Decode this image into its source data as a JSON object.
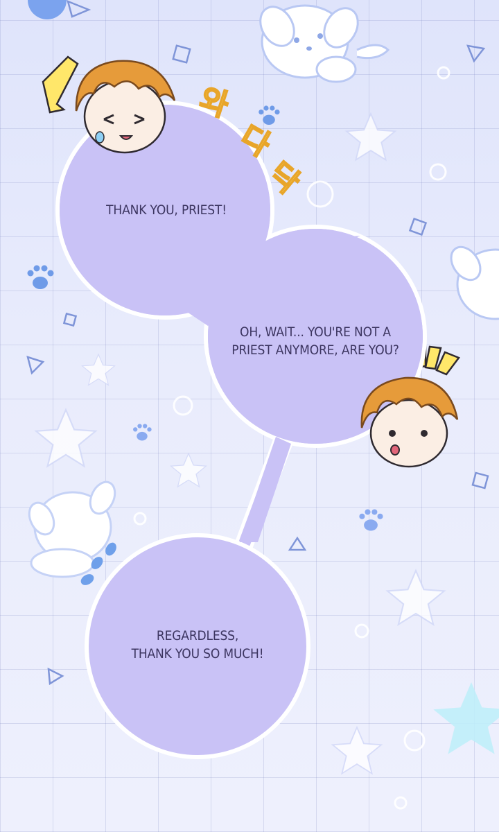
{
  "dialogue": {
    "bubble_1": "THANK YOU, PRIEST!",
    "bubble_2_line_1": "OH, WAIT... YOU'RE NOT A",
    "bubble_2_line_2": "PRIEST ANYMORE, ARE YOU?",
    "bubble_3_line_1": "REGARDLESS,",
    "bubble_3_line_2": "THANK YOU SO MUCH!"
  },
  "sound_effect": {
    "glyph_1": "와",
    "glyph_2": "다",
    "glyph_3": "닥"
  },
  "colors": {
    "bubble_fill": "#c9c2f6",
    "bubble_outline": "#ffffff",
    "text": "#3c3560",
    "hair": "#e69b3a",
    "star": "#ffffff",
    "paw": "#6f9be8"
  },
  "icons": [
    "star-icon",
    "paw-print-icon",
    "puppy-doodle-icon",
    "triangle-icon",
    "diamond-icon",
    "circle-icon",
    "exclamation-mark-icon"
  ]
}
